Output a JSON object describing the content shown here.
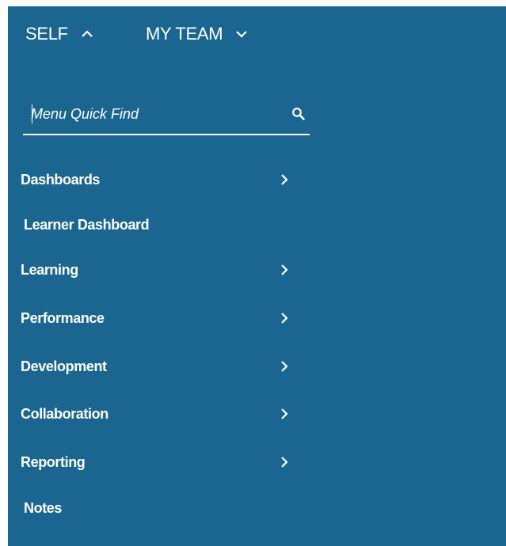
{
  "tabs": [
    {
      "label": "SELF",
      "chevron": "chevron-up-icon"
    },
    {
      "label": "MY TEAM",
      "chevron": "chevron-down-icon"
    }
  ],
  "search": {
    "placeholder": "Menu Quick Find",
    "icon": "search-icon"
  },
  "menu": [
    {
      "label": "Dashboards",
      "has_submenu": true
    },
    {
      "label": "Learner Dashboard",
      "has_submenu": false
    },
    {
      "label": "Learning",
      "has_submenu": true
    },
    {
      "label": "Performance",
      "has_submenu": true
    },
    {
      "label": "Development",
      "has_submenu": true
    },
    {
      "label": "Collaboration",
      "has_submenu": true
    },
    {
      "label": "Reporting",
      "has_submenu": true
    },
    {
      "label": "Notes",
      "has_submenu": false
    }
  ],
  "colors": {
    "panel_background": "#1b6690",
    "text": "#ffffff",
    "page_background": "#ffffff"
  }
}
